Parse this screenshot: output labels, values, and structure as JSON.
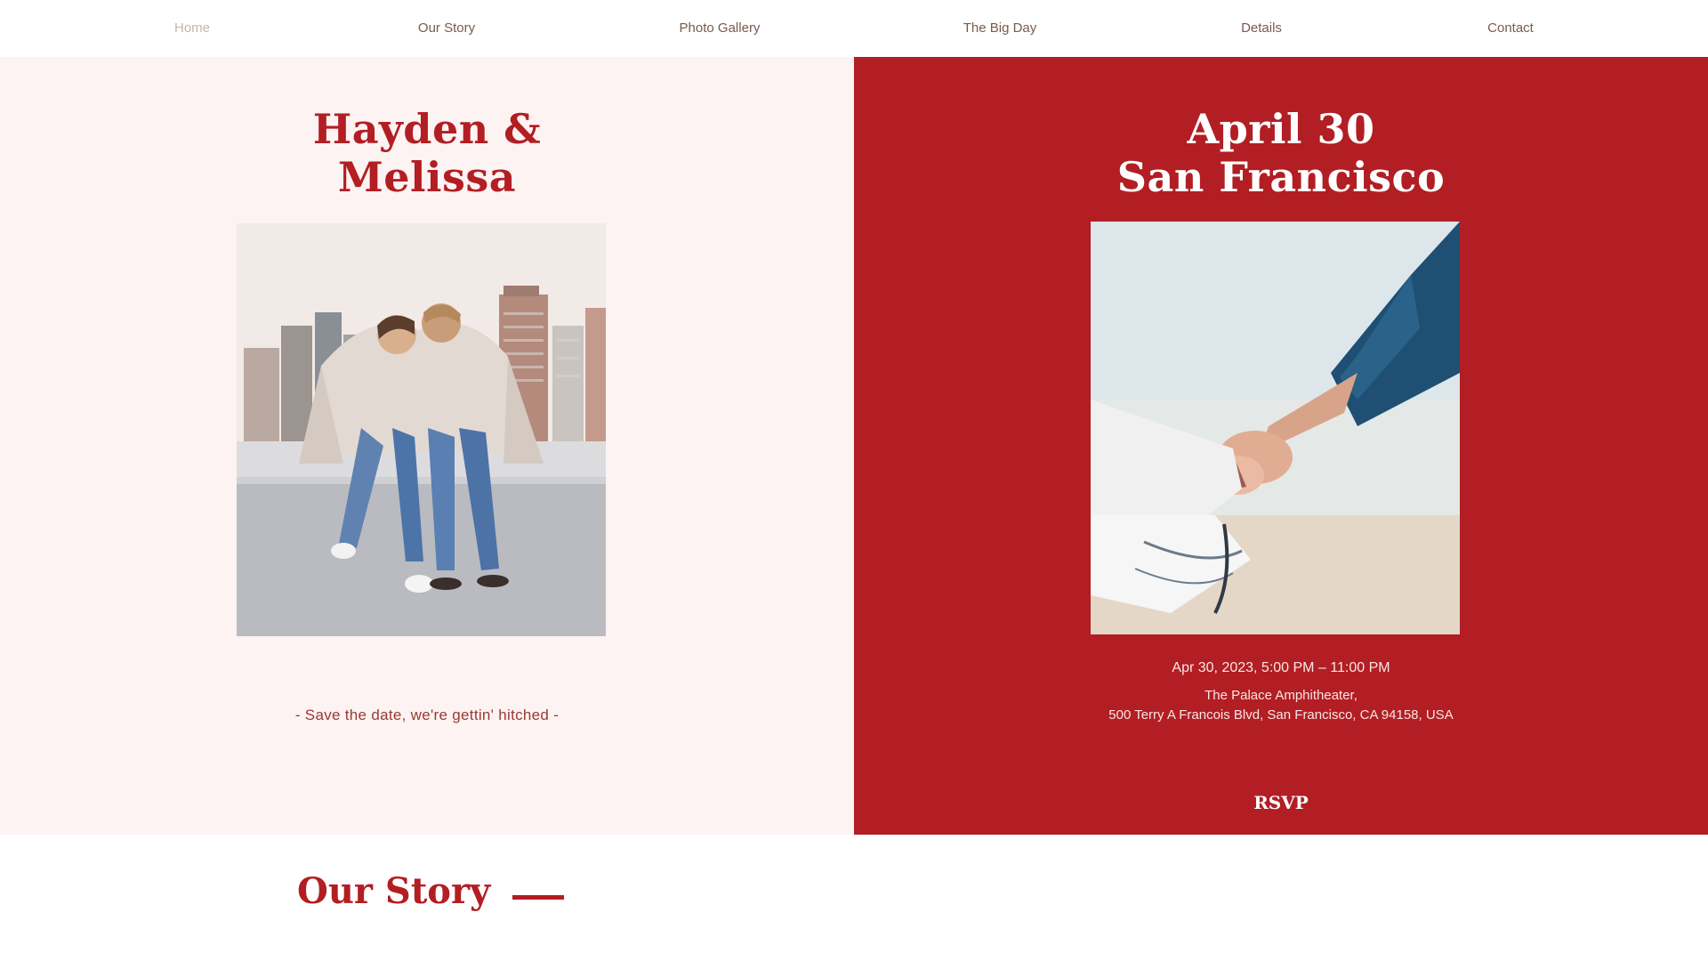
{
  "nav": {
    "items": [
      "Home",
      "Our Story",
      "Photo Gallery",
      "The Big Day",
      "Details",
      "Contact"
    ],
    "active": "Home"
  },
  "hero_left": {
    "title_line1": "Hayden &",
    "title_line2": "Melissa",
    "tagline": "- Save the date, we're gettin' hitched -"
  },
  "hero_right": {
    "title_line1": "April 30",
    "title_line2": "San Francisco",
    "event_datetime": "Apr 30, 2023, 5:00 PM – 11:00 PM",
    "venue_name": "The Palace Amphitheater,",
    "venue_address": "500 Terry A Francois Blvd, San Francisco, CA 94158, USA",
    "rsvp_label": "RSVP"
  },
  "story": {
    "title": "Our Story"
  },
  "colors": {
    "accent": "#b21e23",
    "panel_light": "#fcf3f2",
    "nav_text": "#7a5a4a",
    "nav_active": "#c8b3a8"
  }
}
